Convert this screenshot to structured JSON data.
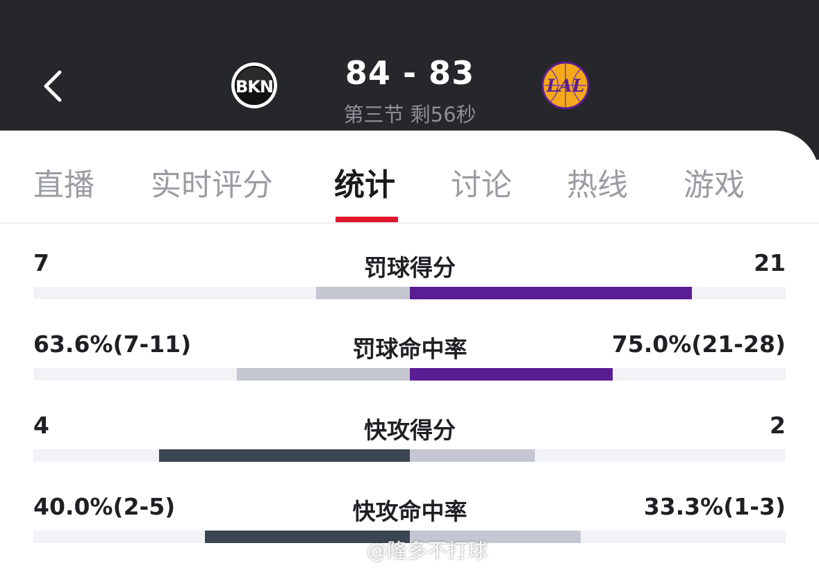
{
  "colors": {
    "header_bg": "#26272b",
    "active_tab_indicator": "#e0182b",
    "bar_track": "#f1f3f6",
    "bar_light": "#c4c7d1",
    "bar_purple": "#5b1d93",
    "bar_dark": "#3c4552"
  },
  "header": {
    "back_icon": "chevron-left-icon",
    "home_team_abbr": "BKN",
    "away_team_abbr": "LAL",
    "score": "84 - 83",
    "status": "第三节 剩56秒"
  },
  "tabs": [
    {
      "label": "直播",
      "active": false
    },
    {
      "label": "实时评分",
      "active": false
    },
    {
      "label": "统计",
      "active": true
    },
    {
      "label": "讨论",
      "active": false
    },
    {
      "label": "热线",
      "active": false
    },
    {
      "label": "游戏",
      "active": false
    }
  ],
  "stats": [
    {
      "name": "罚球得分",
      "left": "7",
      "right": "21",
      "left_fraction": 0.25,
      "right_fraction": 0.75,
      "leader": "right"
    },
    {
      "name": "罚球命中率",
      "left": "63.6%(7-11)",
      "right": "75.0%(21-28)",
      "left_fraction": 0.46,
      "right_fraction": 0.54,
      "leader": "right"
    },
    {
      "name": "快攻得分",
      "left": "4",
      "right": "2",
      "left_fraction": 0.667,
      "right_fraction": 0.333,
      "leader": "left"
    },
    {
      "name": "快攻命中率",
      "left": "40.0%(2-5)",
      "right": "33.3%(1-3)",
      "left_fraction": 0.545,
      "right_fraction": 0.455,
      "leader": "left"
    }
  ],
  "watermark": "@隆多不打球"
}
